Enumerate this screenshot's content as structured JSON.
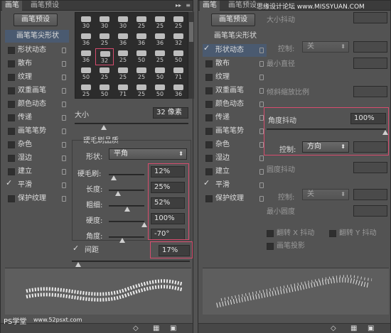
{
  "left": {
    "tabs": [
      "画笔",
      "画笔预设"
    ],
    "preset_button": "画笔预设",
    "sidebar": [
      {
        "label": "画笔笔尖形状",
        "checkbox": false,
        "lock": false,
        "selected": true
      },
      {
        "label": "形状动态",
        "checkbox": true,
        "checked": false,
        "lock": true
      },
      {
        "label": "散布",
        "checkbox": true,
        "checked": false,
        "lock": true
      },
      {
        "label": "纹理",
        "checkbox": true,
        "checked": false,
        "lock": true
      },
      {
        "label": "双重画笔",
        "checkbox": true,
        "checked": false,
        "lock": true
      },
      {
        "label": "颜色动态",
        "checkbox": true,
        "checked": false,
        "lock": true
      },
      {
        "label": "传递",
        "checkbox": true,
        "checked": false,
        "lock": true
      },
      {
        "label": "画笔笔势",
        "checkbox": true,
        "checked": false,
        "lock": true
      },
      {
        "label": "杂色",
        "checkbox": true,
        "checked": false,
        "lock": true
      },
      {
        "label": "湿边",
        "checkbox": true,
        "checked": false,
        "lock": true
      },
      {
        "label": "建立",
        "checkbox": true,
        "checked": false,
        "lock": true
      },
      {
        "label": "平滑",
        "checkbox": true,
        "checked": true,
        "lock": true
      },
      {
        "label": "保护纹理",
        "checkbox": true,
        "checked": false,
        "lock": true
      }
    ],
    "brush_sizes": [
      [
        "30",
        "30",
        "30",
        "25",
        "25",
        "25"
      ],
      [
        "36",
        "25",
        "36",
        "36",
        "36",
        "32"
      ],
      [
        "36",
        "32",
        "25",
        "50",
        "25",
        "50"
      ],
      [
        "50",
        "25",
        "25",
        "25",
        "50",
        "71"
      ],
      [
        "25",
        "50",
        "71",
        "25",
        "50",
        "36"
      ]
    ],
    "size_label": "大小",
    "size_value": "32 像素",
    "bristle_title": "硬毛刷品质",
    "shape_label": "形状:",
    "shape_value": "平角",
    "params": [
      {
        "label": "硬毛刷:",
        "value": "12%"
      },
      {
        "label": "长度:",
        "value": "25%"
      },
      {
        "label": "粗细:",
        "value": "52%"
      },
      {
        "label": "硬度:",
        "value": "100%"
      },
      {
        "label": "角度:",
        "value": "-70°"
      }
    ],
    "spacing_label": "间距",
    "spacing_value": "17%",
    "spacing_checked": true
  },
  "right": {
    "tabs": [
      "画笔",
      "画笔预设"
    ],
    "preset_button": "画笔预设",
    "sidebar": [
      {
        "label": "画笔笔尖形状",
        "checkbox": false,
        "lock": false
      },
      {
        "label": "形状动态",
        "checkbox": true,
        "checked": true,
        "lock": true,
        "selected": true
      },
      {
        "label": "散布",
        "checkbox": true,
        "checked": false,
        "lock": true
      },
      {
        "label": "纹理",
        "checkbox": true,
        "checked": false,
        "lock": true
      },
      {
        "label": "双重画笔",
        "checkbox": true,
        "checked": false,
        "lock": true
      },
      {
        "label": "颜色动态",
        "checkbox": true,
        "checked": false,
        "lock": true
      },
      {
        "label": "传递",
        "checkbox": true,
        "checked": false,
        "lock": true
      },
      {
        "label": "画笔笔势",
        "checkbox": true,
        "checked": false,
        "lock": true
      },
      {
        "label": "杂色",
        "checkbox": true,
        "checked": false,
        "lock": true
      },
      {
        "label": "湿边",
        "checkbox": true,
        "checked": false,
        "lock": true
      },
      {
        "label": "建立",
        "checkbox": true,
        "checked": false,
        "lock": true
      },
      {
        "label": "平滑",
        "checkbox": true,
        "checked": true,
        "lock": true
      },
      {
        "label": "保护纹理",
        "checkbox": true,
        "checked": false,
        "lock": true
      }
    ],
    "size_jitter": "大小抖动",
    "control_label": "控制:",
    "control_off": "关",
    "min_diameter": "最小直径",
    "tilt_scale": "倾斜缩放比例",
    "angle_jitter": "角度抖动",
    "angle_jitter_value": "100%",
    "angle_control_value": "方向",
    "roundness_jitter": "圆度抖动",
    "min_roundness": "最小圆度",
    "flip_x": "翻转 X 抖动",
    "flip_y": "翻转 Y 抖动",
    "brush_projection": "画笔投影"
  },
  "watermarks": {
    "top": "思缘设计论坛 www.MISSYUAN.COM",
    "ps": "PS学堂",
    "url": "www.52psxt.com"
  },
  "colors": {
    "accent_box": "#d74c6e",
    "panel_bg": "#535353"
  }
}
